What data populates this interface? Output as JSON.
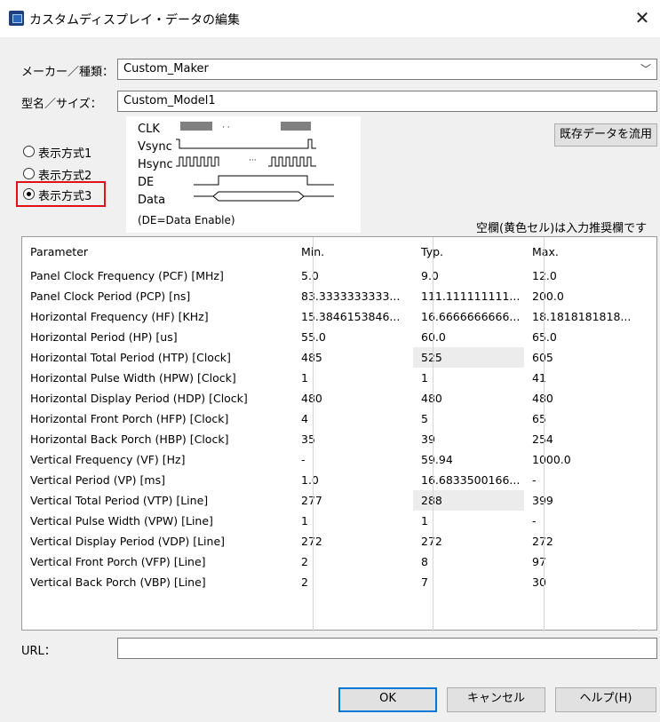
{
  "window": {
    "title": "カスタムディスプレイ・データの編集",
    "close_glyph": "✕",
    "app_icon": "display-app-icon"
  },
  "form": {
    "maker_label": "メーカー／種類：",
    "maker_value": "Custom_Maker",
    "model_label": "型名／サイズ：",
    "model_value": "Custom_Model1"
  },
  "display_modes": [
    {
      "label": "表示方式1",
      "selected": false
    },
    {
      "label": "表示方式2",
      "selected": false
    },
    {
      "label": "表示方式3",
      "selected": true
    }
  ],
  "diagram": {
    "signals": [
      "CLK",
      "Vsync",
      "Hsync",
      "DE",
      "Data"
    ],
    "note": "(DE=Data Enable)"
  },
  "reuse_button": "既存データを流用",
  "hint": "空欄(黄色セル)は入力推奨欄です",
  "table": {
    "columns": [
      "Parameter",
      "Min.",
      "Typ.",
      "Max."
    ],
    "rows": [
      [
        "Panel Clock Frequency (PCF) [MHz]",
        "5.0",
        "9.0",
        "12.0"
      ],
      [
        "Panel Clock Period (PCP) [ns]",
        "83.3333333333...",
        "111.111111111...",
        "200.0"
      ],
      [
        "Horizontal Frequency (HF) [KHz]",
        "15.3846153846...",
        "16.6666666666...",
        "18.1818181818..."
      ],
      [
        "Horizontal Period (HP) [us]",
        "55.0",
        "60.0",
        "65.0"
      ],
      [
        "Horizontal Total Period (HTP) [Clock]",
        "485",
        "525",
        "605"
      ],
      [
        "Horizontal Pulse Width (HPW) [Clock]",
        "1",
        "1",
        "41"
      ],
      [
        "Horizontal Display Period (HDP) [Clock]",
        "480",
        "480",
        "480"
      ],
      [
        "Horizontal Front Porch (HFP) [Clock]",
        "4",
        "5",
        "65"
      ],
      [
        "Horizontal Back Porch (HBP) [Clock]",
        "35",
        "39",
        "254"
      ],
      [
        "Vertical Frequency (VF) [Hz]",
        "-",
        "59.94",
        "1000.0"
      ],
      [
        "Vertical Period (VP) [ms]",
        "1.0",
        "16.6833500166...",
        "-"
      ],
      [
        "Vertical Total Period (VTP) [Line]",
        "277",
        "288",
        "399"
      ],
      [
        "Vertical Pulse Width (VPW) [Line]",
        "1",
        "1",
        "-"
      ],
      [
        "Vertical Display Period (VDP) [Line]",
        "272",
        "272",
        "272"
      ],
      [
        "Vertical Front Porch (VFP) [Line]",
        "2",
        "8",
        "97"
      ],
      [
        "Vertical Back Porch (VBP) [Line]",
        "2",
        "7",
        "30"
      ]
    ],
    "shaded_typ_rows": [
      4,
      11
    ]
  },
  "url": {
    "label": "URL：",
    "value": ""
  },
  "buttons": {
    "ok": "OK",
    "cancel": "キャンセル",
    "help": "ヘルプ(H)"
  },
  "colors": {
    "highlight": "#e0101a",
    "default_button_border": "#0078d7"
  }
}
